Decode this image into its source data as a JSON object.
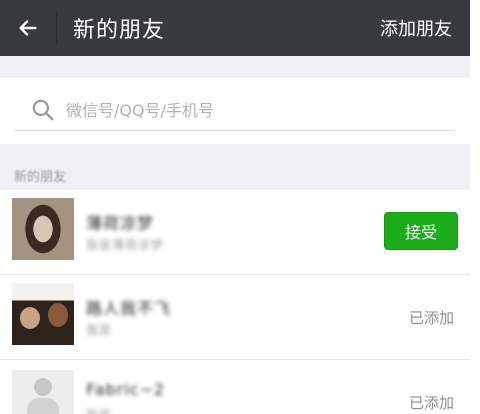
{
  "header": {
    "title": "新的朋友",
    "add_friend_label": "添加朋友"
  },
  "search": {
    "placeholder": "微信号/QQ号/手机号",
    "value": ""
  },
  "section": {
    "label": "新的朋友"
  },
  "requests": [
    {
      "name": "薄荷凉梦",
      "message": "我是薄荷凉梦",
      "status": "接受",
      "status_type": "button"
    },
    {
      "name": "路人我不飞",
      "message": "我是",
      "status": "已添加",
      "status_type": "text"
    },
    {
      "name": "Fabric~2",
      "message": "我是",
      "status": "已添加",
      "status_type": "text"
    }
  ],
  "colors": {
    "topbar": "#393a3f",
    "accept": "#1aad19",
    "background": "#efeff4"
  }
}
